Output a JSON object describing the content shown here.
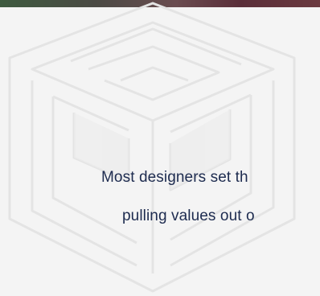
{
  "content": {
    "line_1": "Most designers set th",
    "line_2": "pulling values out o"
  },
  "colors": {
    "background": "#f4f4f4",
    "text": "#1d2b4f",
    "hero_strip": "#5a2e39",
    "watermark": "#e2e2e2"
  },
  "icons": {
    "watermark": "cube-logo-icon"
  }
}
